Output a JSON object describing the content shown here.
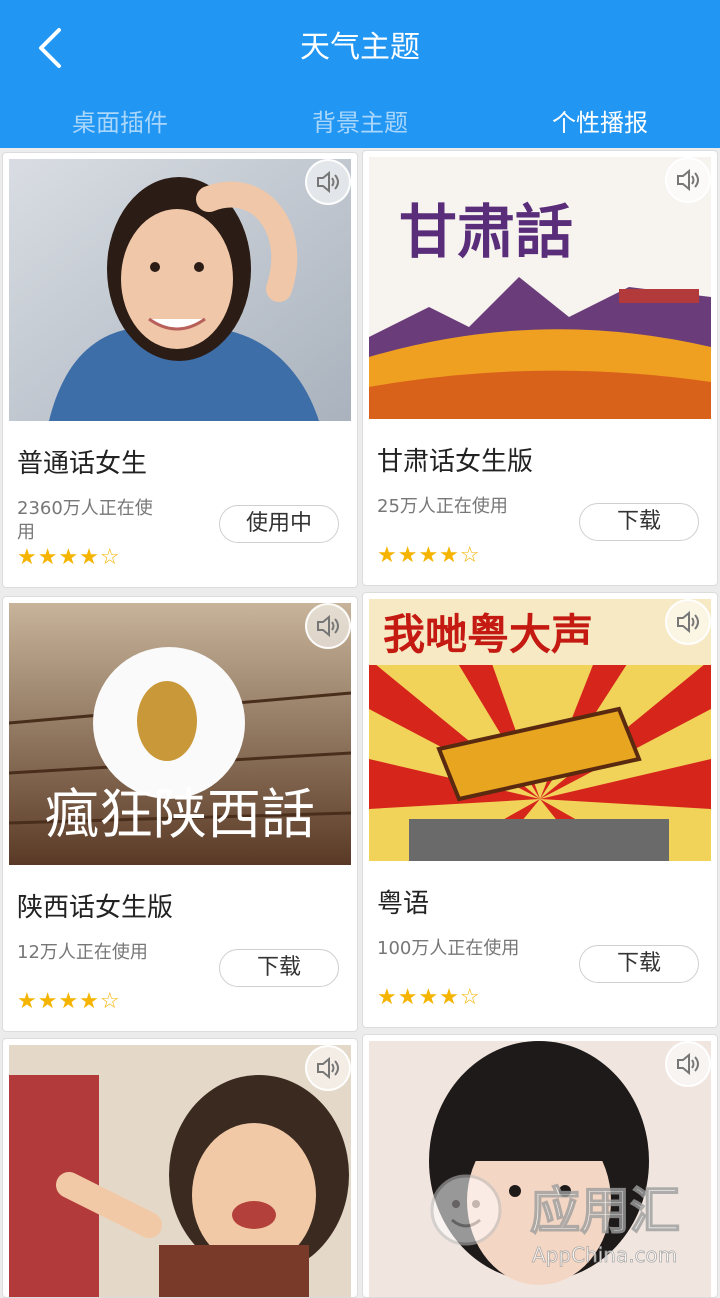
{
  "header": {
    "title": "天气主题",
    "back_icon": "chevron-left-icon"
  },
  "tabs": [
    {
      "label": "桌面插件",
      "active": false
    },
    {
      "label": "背景主题",
      "active": false
    },
    {
      "label": "个性播报",
      "active": true
    }
  ],
  "cards": [
    {
      "name": "普通话女生",
      "users": "2360万人正在使用",
      "rating": 4,
      "stars": "★★★★☆",
      "button": "使用中"
    },
    {
      "name": "甘肃话女生版",
      "users": "25万人正在使用",
      "rating": 4,
      "stars": "★★★★☆",
      "button": "下载",
      "image_text": "甘肃話"
    },
    {
      "name": "陕西话女生版",
      "users": "12万人正在使用",
      "rating": 4,
      "stars": "★★★★☆",
      "button": "下载",
      "image_text": "瘋狂陕西話"
    },
    {
      "name": "粤语",
      "users": "100万人正在使用",
      "rating": 4,
      "stars": "★★★★☆",
      "button": "下载",
      "image_text": "我哋粤大声"
    },
    {
      "name": "",
      "users": "",
      "rating": null,
      "stars": "",
      "button": ""
    },
    {
      "name": "",
      "users": "",
      "rating": null,
      "stars": "",
      "button": ""
    }
  ],
  "watermark": {
    "text": "应用汇",
    "sub": "AppChina.com"
  },
  "colors": {
    "header": "#2196f3",
    "star": "#f5b400",
    "tab_inactive": "#a9d6fb"
  }
}
